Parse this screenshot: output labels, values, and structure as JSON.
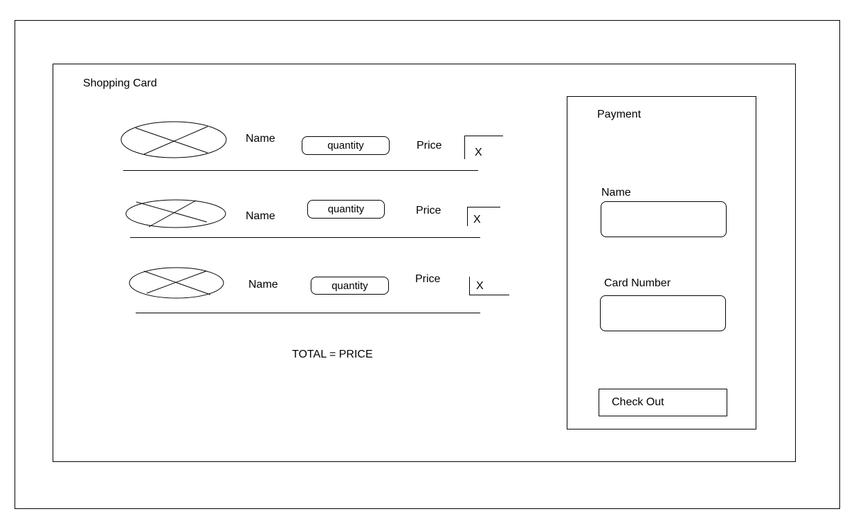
{
  "cart": {
    "title": "Shopping Card",
    "items": [
      {
        "name": "Name",
        "quantity": "quantity",
        "price": "Price",
        "remove": "X"
      },
      {
        "name": "Name",
        "quantity": "quantity",
        "price": "Price",
        "remove": "X"
      },
      {
        "name": "Name",
        "quantity": "quantity",
        "price": "Price",
        "remove": "X"
      }
    ],
    "total": "TOTAL = PRICE"
  },
  "payment": {
    "title": "Payment",
    "name_label": "Name",
    "name_value": "",
    "card_label": "Card Number",
    "card_value": "",
    "checkout_label": "Check Out"
  },
  "icons": {
    "product_image": "image-placeholder-icon"
  }
}
